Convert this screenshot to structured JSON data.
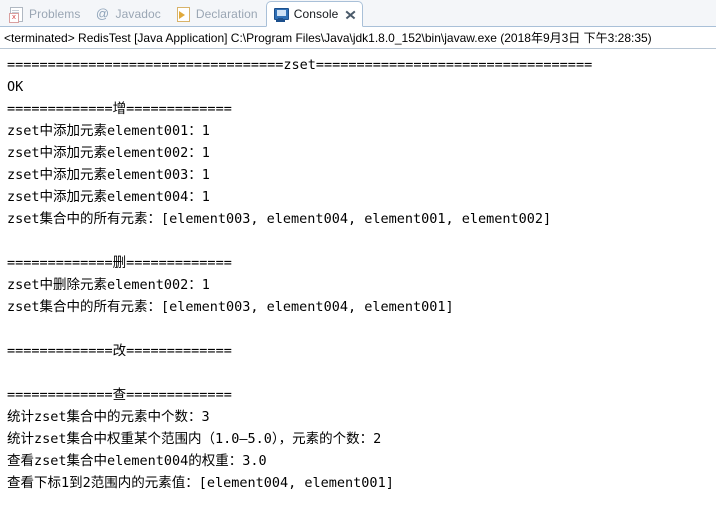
{
  "tabs": [
    {
      "label": "Problems",
      "icon": "problems-icon",
      "active": false,
      "closable": false
    },
    {
      "label": "Javadoc",
      "icon": "at-icon",
      "active": false,
      "closable": false
    },
    {
      "label": "Declaration",
      "icon": "declaration-icon",
      "active": false,
      "closable": false
    },
    {
      "label": "Console",
      "icon": "console-monitor-icon",
      "active": true,
      "closable": true
    }
  ],
  "process_header": "<terminated> RedisTest [Java Application] C:\\Program Files\\Java\\jdk1.8.0_152\\bin\\javaw.exe (2018年9月3日 下午3:28:35)",
  "console_output": [
    "==================================zset==================================",
    "OK",
    "=============增=============",
    "zset中添加元素element001：1",
    "zset中添加元素element002：1",
    "zset中添加元素element003：1",
    "zset中添加元素element004：1",
    "zset集合中的所有元素：[element003, element004, element001, element002]",
    "",
    "=============删=============",
    "zset中删除元素element002：1",
    "zset集合中的所有元素：[element003, element004, element001]",
    "",
    "=============改=============",
    "",
    "=============查=============",
    "统计zset集合中的元素中个数：3",
    "统计zset集合中权重某个范围内（1.0—5.0），元素的个数：2",
    "查看zset集合中element004的权重：3.0",
    "查看下标1到2范围内的元素值：[element004, element001]"
  ],
  "colors": {
    "tab_active_bg": "#ffffff",
    "tab_inactive_text": "#9aa6b4",
    "tabbar_bg": "#f4f6f9",
    "border": "#a9c0d8",
    "console_text": "#000000",
    "console_bg": "#ffffff"
  }
}
